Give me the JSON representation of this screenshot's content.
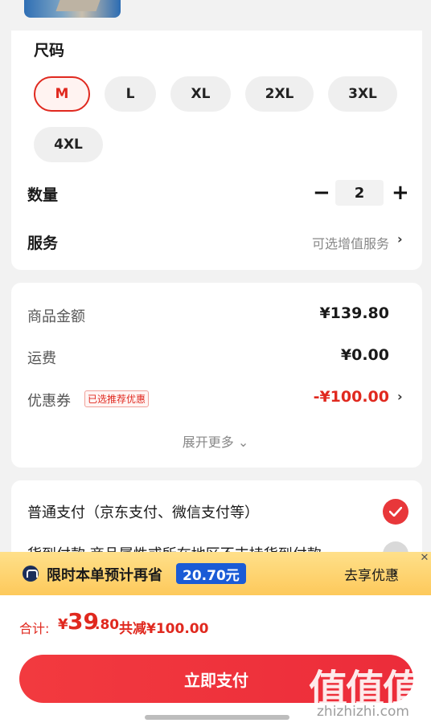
{
  "size": {
    "title": "尺码",
    "options": [
      "M",
      "L",
      "XL",
      "2XL",
      "3XL",
      "4XL"
    ],
    "selected": "M"
  },
  "quantity": {
    "label": "数量",
    "value": "2",
    "minus": "−",
    "plus": "+"
  },
  "service": {
    "label": "服务",
    "hint": "可选增值服务",
    "chevron": "›"
  },
  "price": {
    "goods_label": "商品金额",
    "goods_value": "¥139.80",
    "shipping_label": "运费",
    "shipping_value": "¥0.00",
    "coupon_label": "优惠券",
    "coupon_tag": "已选推荐优惠",
    "coupon_value": "-¥100.00",
    "expand": "展开更多 ⌄"
  },
  "payment": {
    "option1": "普通支付（京东支付、微信支付等）",
    "option2": "货到付款  商品属性或所在地区不支持货到付款"
  },
  "promo": {
    "text": "限时本单预计再省",
    "amount": "20.70元",
    "cta": "去享优惠",
    "chevron": "›",
    "close": "✕"
  },
  "total": {
    "label": "合计:",
    "yen": "¥",
    "integer": "39",
    "decimal": ".80",
    "discount": "共减¥100.00"
  },
  "pay_button": "立即支付",
  "watermark": {
    "logo": "值值值",
    "url": "zhizhizhi.com"
  },
  "colors": {
    "accent": "#e0291f",
    "promo_bg": "#fdc95b",
    "promo_badge": "#1a5bd6"
  }
}
